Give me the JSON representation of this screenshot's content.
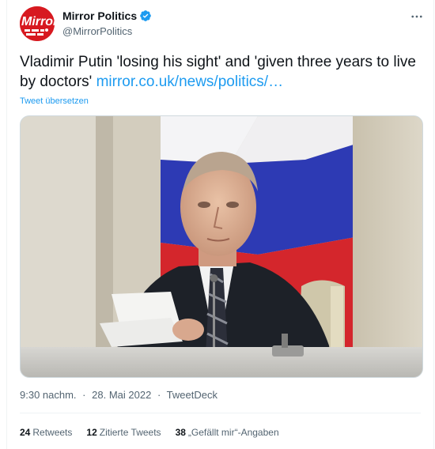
{
  "account": {
    "display_name": "Mirror Politics",
    "handle": "@MirrorPolitics",
    "avatar_text": "Mirror",
    "verified": true
  },
  "tweet": {
    "text": "Vladimir Putin 'losing his sight' and 'given three years to live by doctors' ",
    "link": "mirror.co.uk/news/politics/…",
    "translate_label": "Tweet übersetzen"
  },
  "meta": {
    "time": "9:30 nachm.",
    "separator": "·",
    "date": "28. Mai 2022",
    "source": "TweetDeck"
  },
  "stats": {
    "retweets_count": "24",
    "retweets_label": "Retweets",
    "quotes_count": "12",
    "quotes_label": "Zitierte Tweets",
    "likes_count": "38",
    "likes_label": "„Gefällt mir“-Angaben"
  },
  "icons": {
    "verified": "verified-badge-icon",
    "more": "more-options-icon"
  },
  "colors": {
    "accent": "#1d9bf0",
    "avatar_bg": "#d71920",
    "text_primary": "#0f1419",
    "text_secondary": "#536471"
  }
}
